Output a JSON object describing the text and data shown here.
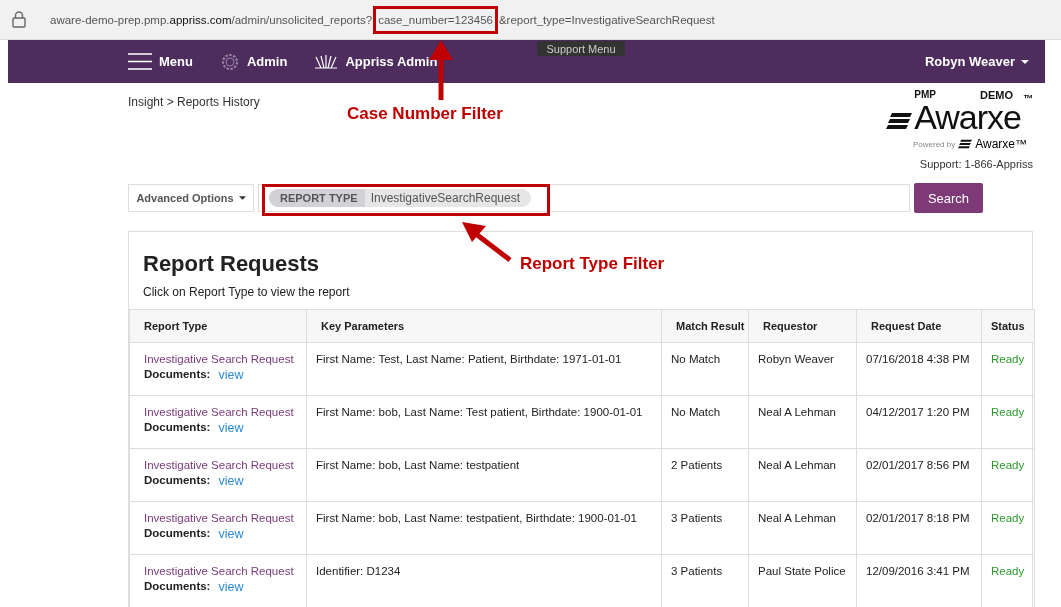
{
  "address_bar": {
    "url_prefix": "aware-demo-prep.pmp.",
    "url_domain": "appriss.com",
    "url_path": "/admin/unsolicited_reports?",
    "url_highlight": "case_number=123456",
    "url_rest": "&report_type=InvestigativeSearchRequest"
  },
  "nav": {
    "items": [
      {
        "label": "Menu",
        "kind": "menu"
      },
      {
        "label": "Admin",
        "kind": "gear"
      },
      {
        "label": "Appriss Admin",
        "kind": "badge"
      }
    ],
    "user": "Robyn Weaver"
  },
  "tooltip": "Support Menu",
  "breadcrumb": "Insight > Reports History",
  "logo": {
    "prefix": "PMP",
    "tag": "DEMO",
    "name": "Awarxe",
    "tm": "™",
    "powered_by": "Powered by",
    "small_name": "Awarxe™"
  },
  "support": {
    "label": "Support:",
    "phone": "1-866-Appriss"
  },
  "search": {
    "advanced_options": "Advanced Options",
    "filter_key": "REPORT TYPE",
    "filter_value": "InvestigativeSearchRequest",
    "button": "Search"
  },
  "report_requests": {
    "title": "Report Requests",
    "subtitle": "Click on Report Type to view the report",
    "columns": [
      "Report Type",
      "Key Parameters",
      "Match Result",
      "Requestor",
      "Request Date",
      "Status"
    ],
    "rows": [
      {
        "report_type": "Investigative Search Request",
        "documents_label": "Documents:",
        "documents_link": "view",
        "key_parameters": "First Name: Test, Last Name: Patient, Birthdate: 1971-01-01",
        "match_result": "No Match",
        "requestor": "Robyn Weaver",
        "request_date": "07/16/2018 4:38 PM",
        "status": "Ready"
      },
      {
        "report_type": "Investigative Search Request",
        "documents_label": "Documents:",
        "documents_link": "view",
        "key_parameters": "First Name: bob, Last Name: Test patient, Birthdate: 1900-01-01",
        "match_result": "No Match",
        "requestor": "Neal A Lehman",
        "request_date": "04/12/2017 1:20 PM",
        "status": "Ready"
      },
      {
        "report_type": "Investigative Search Request",
        "documents_label": "Documents:",
        "documents_link": "view",
        "key_parameters": "First Name: bob, Last Name: testpatient",
        "match_result": "2 Patients",
        "requestor": "Neal A Lehman",
        "request_date": "02/01/2017 8:56 PM",
        "status": "Ready"
      },
      {
        "report_type": "Investigative Search Request",
        "documents_label": "Documents:",
        "documents_link": "view",
        "key_parameters": "First Name: bob, Last Name: testpatient, Birthdate: 1900-01-01",
        "match_result": "3 Patients",
        "requestor": "Neal A Lehman",
        "request_date": "02/01/2017 8:18 PM",
        "status": "Ready"
      },
      {
        "report_type": "Investigative Search Request",
        "documents_label": "Documents:",
        "documents_link": "view",
        "key_parameters": "Identifier: D1234",
        "match_result": "3 Patients",
        "requestor": "Paul State Police",
        "request_date": "12/09/2016 3:41 PM",
        "status": "Ready"
      }
    ]
  },
  "annotations": [
    {
      "label": "Case Number Filter"
    },
    {
      "label": "Report Type Filter"
    }
  ]
}
